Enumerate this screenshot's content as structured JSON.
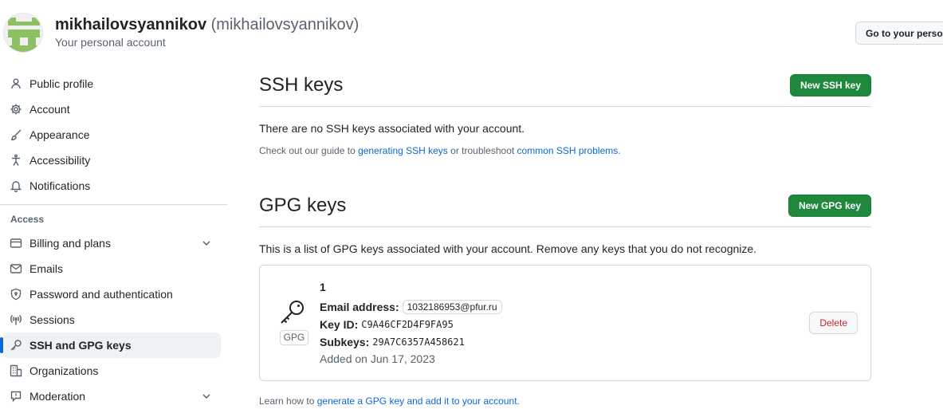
{
  "header": {
    "account_name": "mikhailovsyannikov",
    "account_login": "(mikhailovsyannikov)",
    "account_subtitle": "Your personal account",
    "goto_button": "Go to your personal profile"
  },
  "sidebar": {
    "items": [
      {
        "label": "Public profile",
        "icon": "person-icon"
      },
      {
        "label": "Account",
        "icon": "gear-icon"
      },
      {
        "label": "Appearance",
        "icon": "paintbrush-icon"
      },
      {
        "label": "Accessibility",
        "icon": "accessibility-icon"
      },
      {
        "label": "Notifications",
        "icon": "bell-icon"
      }
    ],
    "access_title": "Access",
    "access_items": [
      {
        "label": "Billing and plans",
        "icon": "credit-card-icon"
      },
      {
        "label": "Emails",
        "icon": "mail-icon"
      },
      {
        "label": "Password and authentication",
        "icon": "shield-lock-icon"
      },
      {
        "label": "Sessions",
        "icon": "broadcast-icon"
      },
      {
        "label": "SSH and GPG keys",
        "icon": "key-icon"
      },
      {
        "label": "Organizations",
        "icon": "organization-icon"
      },
      {
        "label": "Moderation",
        "icon": "report-icon"
      }
    ]
  },
  "ssh": {
    "title": "SSH keys",
    "new_button": "New SSH key",
    "empty_message": "There are no SSH keys associated with your account.",
    "note_prefix": "Check out our guide to ",
    "note_link1": "generating SSH keys",
    "note_middle": " or troubleshoot ",
    "note_link2": "common SSH problems",
    "note_suffix": "."
  },
  "gpg": {
    "title": "GPG keys",
    "new_button": "New GPG key",
    "description": "This is a list of GPG keys associated with your account. Remove any keys that you do not recognize.",
    "keys": [
      {
        "title": "1",
        "email_label": "Email address:",
        "email": "1032186953@pfur.ru",
        "key_id_label": "Key ID:",
        "key_id": "C9A46CF2D4F9FA95",
        "subkeys_label": "Subkeys:",
        "subkeys": "29A7C6357A458621",
        "added": "Added on Jun 17, 2023",
        "badge": "GPG",
        "delete_button": "Delete"
      }
    ],
    "learn_prefix": "Learn how to ",
    "learn_link": "generate a GPG key and add it to your account",
    "learn_suffix": "."
  },
  "colors": {
    "primary_button": "#1f883d",
    "link": "#0969da",
    "danger": "#d1242f",
    "active_indicator": "#0969da"
  }
}
